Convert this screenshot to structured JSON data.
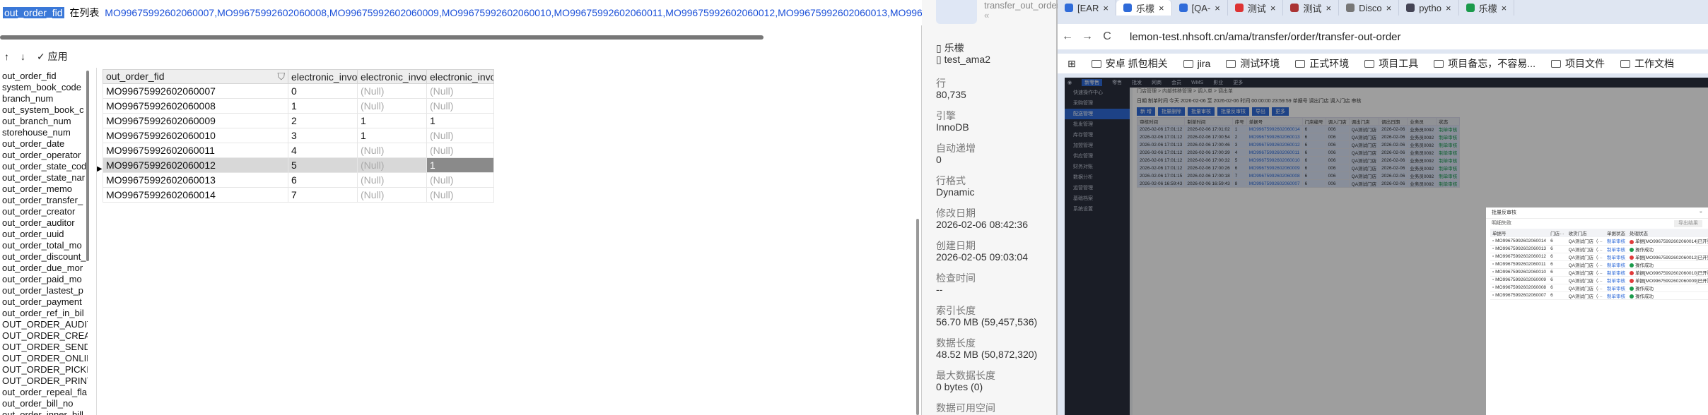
{
  "filter": {
    "field": "out_order_fid",
    "keyword": "在列表",
    "values": "MO99675992602060007,MO99675992602060008,MO99675992602060009,MO99675992602060010,MO99675992602060011,MO99675992602060012,MO99675992602060013,MO9967599260"
  },
  "toolbar": {
    "up": "↑",
    "down": "↓",
    "apply_label": "应用",
    "apply_check": "✓"
  },
  "field_list": [
    "out_order_fid",
    "system_book_code",
    "branch_num",
    "out_system_book_c",
    "out_branch_num",
    "storehouse_num",
    "out_order_date",
    "out_order_operator",
    "out_order_state_cod",
    "out_order_state_nar",
    "out_order_memo",
    "out_order_transfer_",
    "out_order_creator",
    "out_order_auditor",
    "out_order_uuid",
    "out_order_total_mo",
    "out_order_discount_",
    "out_order_due_mor",
    "out_order_paid_mo",
    "out_order_lastest_p",
    "out_order_payment",
    "out_order_ref_in_bil",
    "OUT_ORDER_AUDIT",
    "OUT_ORDER_CREAT",
    "OUT_ORDER_SEND",
    "OUT_ORDER_ONLIN",
    "OUT_ORDER_PICKIN",
    "OUT_ORDER_PRINT",
    "out_order_repeal_fla",
    "out_order_bill_no",
    "out_order_inner_bill"
  ],
  "grid": {
    "columns": [
      "out_order_fid",
      "electronic_invoice_state",
      "electronic_invoice_numb",
      "electronic_invoice_id"
    ],
    "rows": [
      [
        "MO99675992602060007",
        "0",
        "(Null)",
        "(Null)"
      ],
      [
        "MO99675992602060008",
        "1",
        "(Null)",
        "(Null)"
      ],
      [
        "MO99675992602060009",
        "2",
        "1",
        "1"
      ],
      [
        "MO99675992602060010",
        "3",
        "1",
        "(Null)"
      ],
      [
        "MO99675992602060011",
        "4",
        "(Null)",
        "(Null)"
      ],
      [
        "MO99675992602060012",
        "5",
        "(Null)",
        "1"
      ],
      [
        "MO99675992602060013",
        "6",
        "(Null)",
        "(Null)"
      ],
      [
        "MO99675992602060014",
        "7",
        "(Null)",
        "(Null)"
      ]
    ],
    "selected_row_index": 5,
    "row_marker": "▶"
  },
  "object_panel": {
    "title_text": "transfer_out_order",
    "close_glyph": "«",
    "user": "乐檬",
    "db": "test_ama2",
    "props": [
      {
        "label": "行",
        "value": "80,735"
      },
      {
        "label": "引擎",
        "value": "InnoDB"
      },
      {
        "label": "自动递增",
        "value": "0"
      },
      {
        "label": "行格式",
        "value": "Dynamic"
      },
      {
        "label": "修改日期",
        "value": "2026-02-06 08:42:36"
      },
      {
        "label": "创建日期",
        "value": "2026-02-05 09:03:04"
      },
      {
        "label": "检查时间",
        "value": "--"
      },
      {
        "label": "索引长度",
        "value": "56.70 MB (59,457,536)"
      },
      {
        "label": "数据长度",
        "value": "48.52 MB (50,872,320)"
      },
      {
        "label": "最大数据长度",
        "value": "0 bytes (0)"
      },
      {
        "label": "数据可用空间",
        "value": ""
      }
    ]
  },
  "browser": {
    "tabs": [
      {
        "label": "[EAR",
        "color": "#2f6bd9"
      },
      {
        "label": "乐檬",
        "color": "#2f6bd9",
        "active": true
      },
      {
        "label": "[QA-",
        "color": "#2f6bd9"
      },
      {
        "label": "测试",
        "color": "#d33"
      },
      {
        "label": "测试",
        "color": "#a33"
      },
      {
        "label": "Disco",
        "color": "#777"
      },
      {
        "label": "pytho",
        "color": "#445"
      },
      {
        "label": "乐檬",
        "color": "#1a9a4b"
      }
    ],
    "nav_back": "←",
    "nav_forward": "→",
    "nav_reload": "C",
    "url": "lemon-test.nhsoft.cn/ama/transfer/order/transfer-out-order",
    "bookmarks": [
      "安卓 抓包相关",
      "jira",
      "测试环境",
      "正式环境",
      "项目工具",
      "项目备忘，不容易...",
      "项目文件",
      "工作文档"
    ]
  },
  "webapp": {
    "top_tabs": [
      "新零售",
      "零售",
      "批发",
      "网商",
      "会员",
      "WMS",
      "影业",
      "更多"
    ],
    "sidebar": [
      "快速操作中心",
      "采购管理",
      "配送管理",
      "批发管理",
      "库存管理",
      "加盟管理",
      "供应管理",
      "财务对账",
      "数据分析",
      "运营管理",
      "基础档案",
      "系统设置"
    ],
    "active_side": "配送管理",
    "crumbs": "门店管理 > 内部转移管理 > 调入单 > 调出单",
    "form": "日期  制单时间  今天  2026-02-06  至  2026-02-06  时间  00:00:00  23:59:59  单据号  调出门店  调入门店  审核",
    "buttons": [
      "新 增",
      "批量删除",
      "批量审核",
      "批量反审核",
      "导出",
      "更多"
    ],
    "columns": [
      "审核时间",
      "制单时间",
      "序号",
      "单据号",
      "门店编号",
      "调入门店",
      "调出门店",
      "调出日期",
      "业务员",
      "状态"
    ],
    "rows": [
      [
        "2026-02-06 17:01:12",
        "2026-02-06 17:01:02",
        "1",
        "MO99675992602060014",
        "6",
        "006",
        "QA测试门店",
        "2026-02-06",
        "业务员0092",
        "制单审核"
      ],
      [
        "2026-02-06 17:01:12",
        "2026-02-06 17:00:54",
        "2",
        "MO99675992602060013",
        "6",
        "006",
        "QA测试门店",
        "2026-02-06",
        "业务员0092",
        "制单审核"
      ],
      [
        "2026-02-06 17:01:13",
        "2026-02-06 17:00:46",
        "3",
        "MO99675992602060012",
        "6",
        "006",
        "QA测试门店",
        "2026-02-06",
        "业务员0092",
        "制单审核"
      ],
      [
        "2026-02-06 17:01:12",
        "2026-02-06 17:00:39",
        "4",
        "MO99675992602060011",
        "6",
        "006",
        "QA测试门店",
        "2026-02-06",
        "业务员0092",
        "制单审核"
      ],
      [
        "2026-02-06 17:01:12",
        "2026-02-06 17:00:32",
        "5",
        "MO99675992602060010",
        "6",
        "006",
        "QA测试门店",
        "2026-02-06",
        "业务员0092",
        "制单审核"
      ],
      [
        "2026-02-06 17:01:12",
        "2026-02-06 17:00:26",
        "6",
        "MO99675992602060009",
        "6",
        "006",
        "QA测试门店",
        "2026-02-06",
        "业务员0092",
        "制单审核"
      ],
      [
        "2026-02-06 17:01:15",
        "2026-02-06 17:00:18",
        "7",
        "MO99675992602060008",
        "6",
        "006",
        "QA测试门店",
        "2026-02-06",
        "业务员0092",
        "制单审核"
      ],
      [
        "2026-02-06 16:59:43",
        "2026-02-06 16:59:43",
        "8",
        "MO99675992602060007",
        "6",
        "006",
        "QA测试门店",
        "2026-02-06",
        "业务员0092",
        "制单审核"
      ]
    ],
    "modal": {
      "title": "批量反审核",
      "sub": "明细失败",
      "btn": "导出结果",
      "close": "×",
      "columns": [
        "单据号",
        "门店···",
        "收货门店",
        "单据状态",
        "处理状态"
      ],
      "rows": [
        [
          "MO99675992602060014",
          "6",
          "QA测试门店（···",
          "制单审核",
          "fail",
          "单据[MO99675992602060014]已开票，不允许反审核 ⓘ"
        ],
        [
          "MO99675992602060013",
          "6",
          "QA测试门店（···",
          "制单审核",
          "ok",
          "操作成功"
        ],
        [
          "MO99675992602060012",
          "6",
          "QA测试门店（···",
          "制单审核",
          "fail",
          "单据[MO99675992602060012]已开票，不允许反审核 ⓘ"
        ],
        [
          "MO99675992602060011",
          "6",
          "QA测试门店（···",
          "制单审核",
          "ok",
          "操作成功"
        ],
        [
          "MO99675992602060010",
          "6",
          "QA测试门店（···",
          "制单审核",
          "fail",
          "单据[MO99675992602060010]已开票，不允许反审核 ⓘ"
        ],
        [
          "MO99675992602060009",
          "6",
          "QA测试门店（···",
          "制单审核",
          "fail",
          "单据[MO99675992602060009]已开票，不允许反审核 ⓘ"
        ],
        [
          "MO99675992602060008",
          "6",
          "QA测试门店（···",
          "制单审核",
          "ok",
          "操作成功"
        ],
        [
          "MO99675992602060007",
          "6",
          "QA测试门店（···",
          "制单审核",
          "ok",
          "操作成功"
        ]
      ]
    }
  }
}
